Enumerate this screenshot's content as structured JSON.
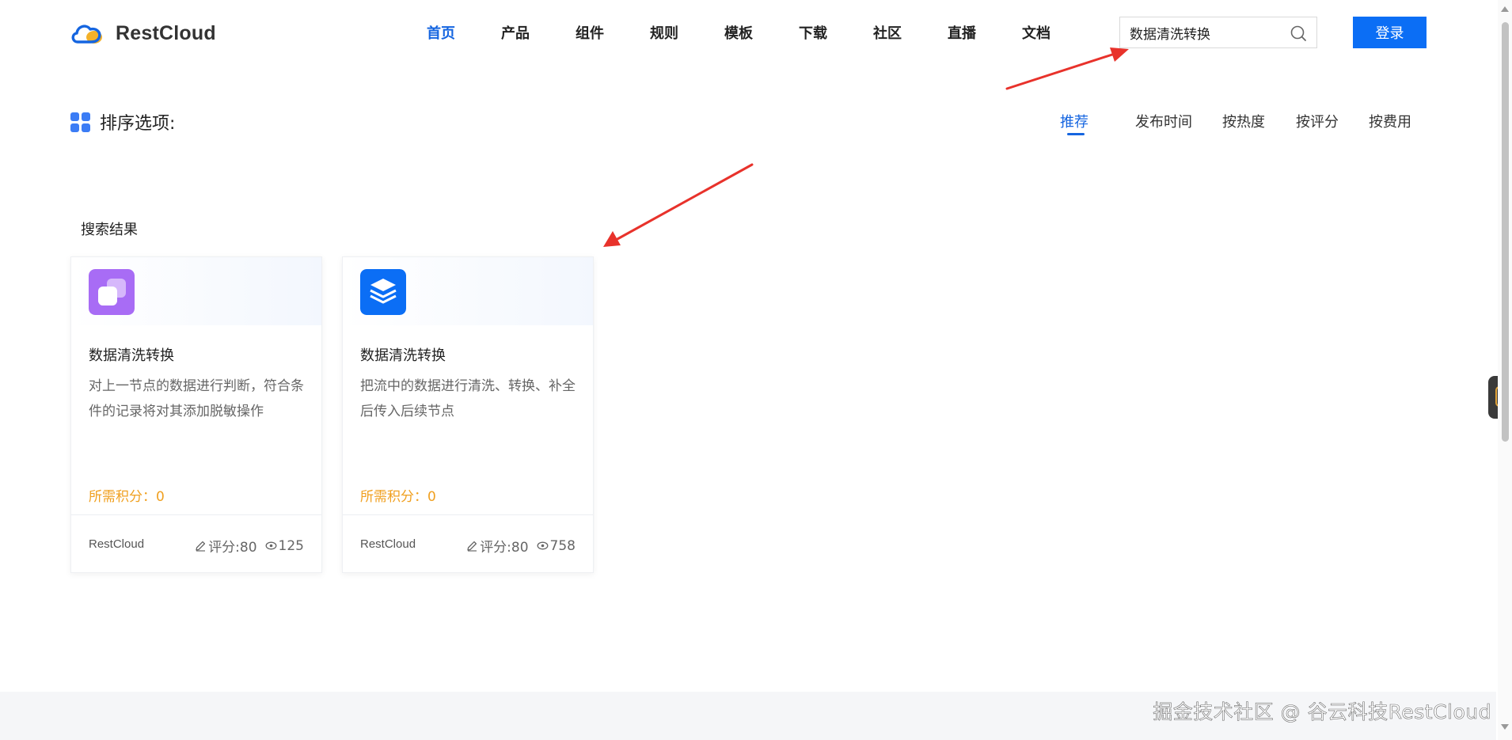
{
  "brand": {
    "name": "RestCloud"
  },
  "nav": {
    "items": [
      {
        "label": "首页",
        "active": true
      },
      {
        "label": "产品"
      },
      {
        "label": "组件"
      },
      {
        "label": "规则"
      },
      {
        "label": "模板"
      },
      {
        "label": "下载"
      },
      {
        "label": "社区"
      },
      {
        "label": "直播"
      },
      {
        "label": "文档"
      }
    ]
  },
  "search": {
    "value": "数据清洗转换",
    "icon": "search-icon"
  },
  "login": {
    "label": "登录"
  },
  "sort": {
    "label": "排序选项:",
    "options": [
      {
        "label": "推荐",
        "active": true
      },
      {
        "label": "发布时间"
      },
      {
        "label": "按热度"
      },
      {
        "label": "按评分"
      },
      {
        "label": "按费用"
      }
    ]
  },
  "results": {
    "title": "搜索结果",
    "cards": [
      {
        "title": "数据清洗转换",
        "description": "对上一节点的数据进行判断，符合条件的记录将对其添加脱敏操作",
        "points": "所需积分：0",
        "vendor": "RestCloud",
        "rating": "评分:80",
        "views": "125",
        "icon": "layers-square-icon",
        "icon_color": "#a86cf5"
      },
      {
        "title": "数据清洗转换",
        "description": "把流中的数据进行清洗、转换、补全后传入后续节点",
        "points": "所需积分：0",
        "vendor": "RestCloud",
        "rating": "评分:80",
        "views": "758",
        "icon": "stack-layers-icon",
        "icon_color": "#0b6ef5"
      }
    ]
  },
  "watermark": "掘金技术社区 @ 谷云科技RestCloud",
  "colors": {
    "primary": "#1565e0",
    "button": "#0b6ef5",
    "points": "#f0a020",
    "arrow": "#e8322b"
  }
}
